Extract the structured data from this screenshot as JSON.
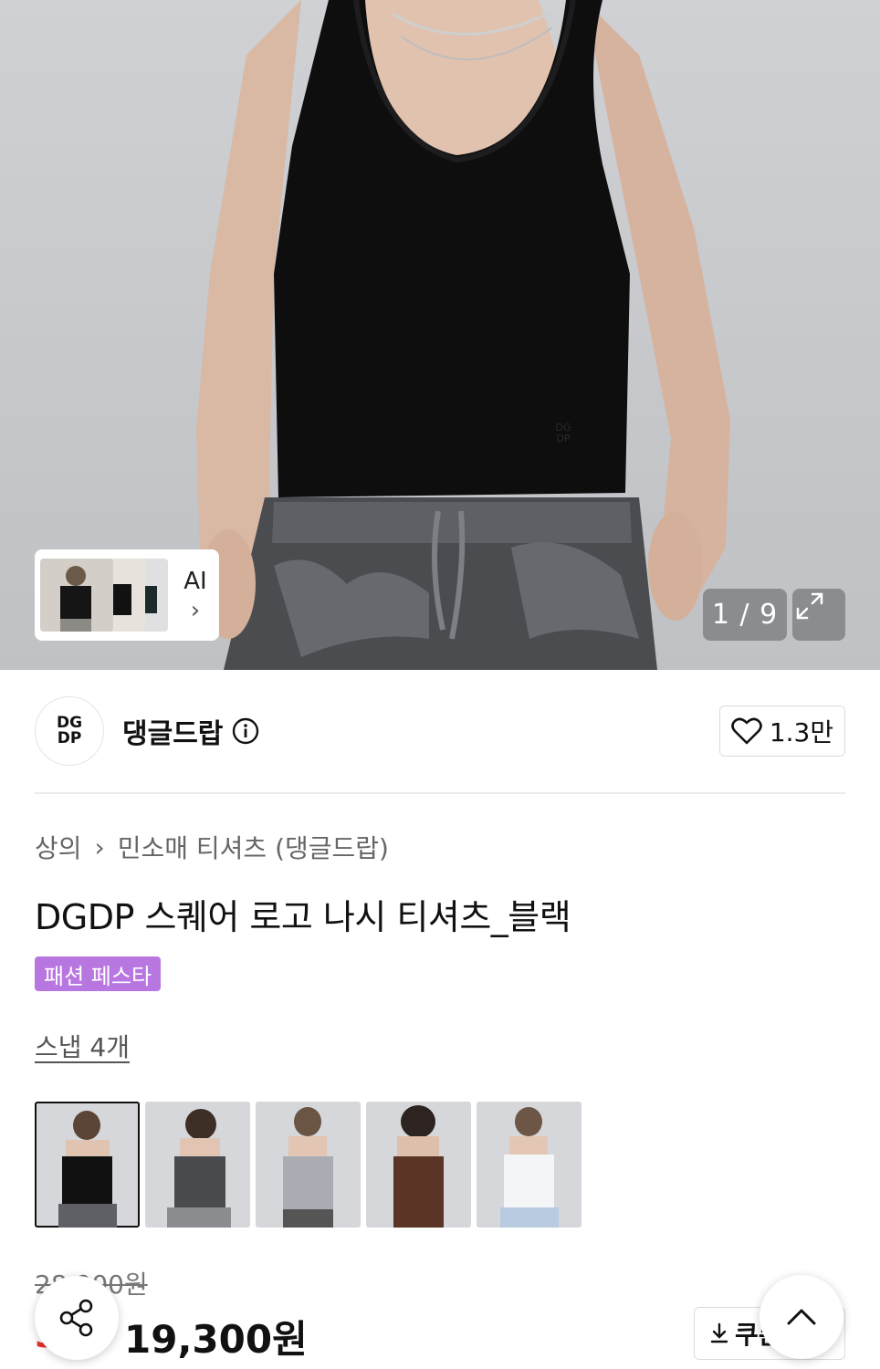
{
  "hero": {
    "counter": "1 / 9",
    "ai_label": "AI",
    "ai_chevron": "›",
    "tank_logo_text": "DG DP"
  },
  "brand": {
    "logo_text": "DG DP",
    "name": "댕글드랍",
    "likes": "1.3만"
  },
  "breadcrumb": {
    "category": "상의",
    "separator": "›",
    "subcategory": "민소매 티셔츠 (댕글드랍)"
  },
  "product": {
    "title": "DGDP 스퀘어 로고 나시 티셔츠_블랙",
    "badge": "패션 페스타",
    "snap_link": "스냅 4개",
    "original_price": "28,900원",
    "discount_mark": "3",
    "price": "19,300원",
    "coupon_label": "쿠폰"
  },
  "snaps": [
    {
      "color": "#111111",
      "label": "black"
    },
    {
      "color": "#4a4b4f",
      "label": "charcoal"
    },
    {
      "color": "#a9adb3",
      "label": "gray"
    },
    {
      "color": "#5a3424",
      "label": "brown"
    },
    {
      "color": "#f4f5f6",
      "label": "white"
    }
  ],
  "colors": {
    "badge_bg": "#b877e0",
    "discount": "#e8312b"
  },
  "icons": {
    "info": "info-icon",
    "heart": "heart-icon",
    "expand": "expand-icon",
    "share": "share-icon",
    "download": "download-icon",
    "chevron_up": "chevron-up-icon"
  }
}
